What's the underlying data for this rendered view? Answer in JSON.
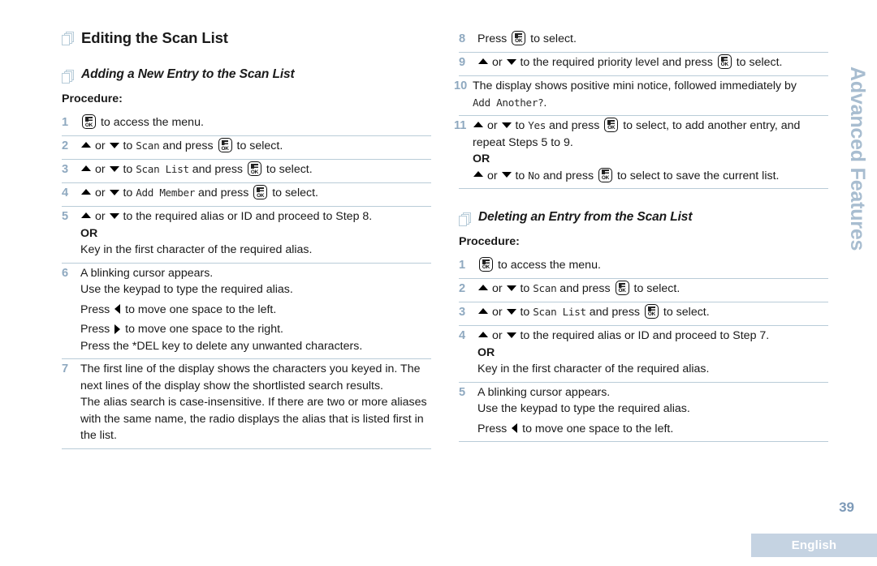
{
  "side_tab": "Advanced Features",
  "footer": {
    "page_number": "39",
    "language": "English"
  },
  "left_column": {
    "section_title": "Editing the Scan List",
    "subsection_title": "Adding a New Entry to the Scan List",
    "procedure_label": "Procedure:",
    "steps": [
      {
        "number": "1",
        "lines": [
          {
            "parts": [
              {
                "type": "okkey"
              },
              {
                "type": "text",
                "value": " to access the menu."
              }
            ]
          }
        ]
      },
      {
        "number": "2",
        "lines": [
          {
            "parts": [
              {
                "type": "tri-up"
              },
              {
                "type": "text",
                "value": " or "
              },
              {
                "type": "tri-down"
              },
              {
                "type": "text",
                "value": " to "
              },
              {
                "type": "lcd",
                "value": "Scan"
              },
              {
                "type": "text",
                "value": " and press "
              },
              {
                "type": "okkey"
              },
              {
                "type": "text",
                "value": " to select."
              }
            ]
          }
        ]
      },
      {
        "number": "3",
        "lines": [
          {
            "parts": [
              {
                "type": "tri-up"
              },
              {
                "type": "text",
                "value": " or "
              },
              {
                "type": "tri-down"
              },
              {
                "type": "text",
                "value": " to "
              },
              {
                "type": "lcd",
                "value": "Scan List"
              },
              {
                "type": "text",
                "value": " and press "
              },
              {
                "type": "okkey"
              },
              {
                "type": "text",
                "value": " to select."
              }
            ]
          }
        ]
      },
      {
        "number": "4",
        "lines": [
          {
            "parts": [
              {
                "type": "tri-up"
              },
              {
                "type": "text",
                "value": " or "
              },
              {
                "type": "tri-down"
              },
              {
                "type": "text",
                "value": " to "
              },
              {
                "type": "lcd",
                "value": "Add Member"
              },
              {
                "type": "text",
                "value": " and press "
              },
              {
                "type": "okkey"
              },
              {
                "type": "text",
                "value": " to select."
              }
            ]
          }
        ]
      },
      {
        "number": "5",
        "lines": [
          {
            "parts": [
              {
                "type": "tri-up"
              },
              {
                "type": "text",
                "value": " or "
              },
              {
                "type": "tri-down"
              },
              {
                "type": "text",
                "value": " to the required alias or ID and proceed to Step 8."
              }
            ]
          },
          {
            "bold": true,
            "parts": [
              {
                "type": "text",
                "value": "OR"
              }
            ]
          },
          {
            "parts": [
              {
                "type": "text",
                "value": "Key in the first character of the required alias."
              }
            ]
          }
        ]
      },
      {
        "number": "6",
        "lines": [
          {
            "parts": [
              {
                "type": "text",
                "value": "A blinking cursor appears."
              }
            ]
          },
          {
            "parts": [
              {
                "type": "text",
                "value": "Use the keypad to type the required alias."
              }
            ]
          },
          {
            "gap": true,
            "parts": [
              {
                "type": "text",
                "value": "Press "
              },
              {
                "type": "tri-left"
              },
              {
                "type": "text",
                "value": " to move one space to the left."
              }
            ]
          },
          {
            "gap": true,
            "parts": [
              {
                "type": "text",
                "value": "Press "
              },
              {
                "type": "tri-right"
              },
              {
                "type": "text",
                "value": " to move one space to the right."
              }
            ]
          },
          {
            "parts": [
              {
                "type": "text",
                "value": "Press the *DEL key to delete any unwanted characters."
              }
            ]
          }
        ]
      },
      {
        "number": "7",
        "lines": [
          {
            "parts": [
              {
                "type": "text",
                "value": "The first line of the display shows the characters you keyed in. The next lines of the display show the shortlisted search results."
              }
            ]
          },
          {
            "parts": [
              {
                "type": "text",
                "value": "The alias search is case-insensitive. If there are two or more aliases with the same name, the radio displays the alias that is listed first in the list."
              }
            ]
          }
        ]
      }
    ]
  },
  "right_column": {
    "steps_continued": [
      {
        "number": "8",
        "lines": [
          {
            "parts": [
              {
                "type": "text",
                "value": "Press "
              },
              {
                "type": "okkey"
              },
              {
                "type": "text",
                "value": " to select."
              }
            ]
          }
        ]
      },
      {
        "number": "9",
        "lines": [
          {
            "parts": [
              {
                "type": "tri-up"
              },
              {
                "type": "text",
                "value": " or "
              },
              {
                "type": "tri-down"
              },
              {
                "type": "text",
                "value": " to the required priority level and press "
              },
              {
                "type": "okkey"
              },
              {
                "type": "text",
                "value": " to select."
              }
            ]
          }
        ]
      },
      {
        "number": "10",
        "lines": [
          {
            "parts": [
              {
                "type": "text",
                "value": "The display shows positive mini notice, followed immediately by "
              },
              {
                "type": "lcd",
                "value": "Add Another?"
              },
              {
                "type": "text",
                "value": "."
              }
            ]
          }
        ]
      },
      {
        "number": "11",
        "lines": [
          {
            "parts": [
              {
                "type": "tri-up"
              },
              {
                "type": "text",
                "value": " or "
              },
              {
                "type": "tri-down"
              },
              {
                "type": "text",
                "value": " to "
              },
              {
                "type": "lcd",
                "value": "Yes"
              },
              {
                "type": "text",
                "value": " and press "
              },
              {
                "type": "okkey"
              },
              {
                "type": "text",
                "value": " to select, to add another entry, and repeat Steps 5 to 9."
              }
            ]
          },
          {
            "bold": true,
            "parts": [
              {
                "type": "text",
                "value": "OR"
              }
            ]
          },
          {
            "parts": [
              {
                "type": "tri-up"
              },
              {
                "type": "text",
                "value": " or "
              },
              {
                "type": "tri-down"
              },
              {
                "type": "text",
                "value": " to "
              },
              {
                "type": "lcd",
                "value": "No"
              },
              {
                "type": "text",
                "value": " and press "
              },
              {
                "type": "okkey"
              },
              {
                "type": "text",
                "value": " to select to save the current list."
              }
            ]
          }
        ]
      }
    ],
    "subsection_title": "Deleting an Entry from the Scan List",
    "procedure_label": "Procedure:",
    "steps": [
      {
        "number": "1",
        "lines": [
          {
            "parts": [
              {
                "type": "okkey"
              },
              {
                "type": "text",
                "value": " to access the menu."
              }
            ]
          }
        ]
      },
      {
        "number": "2",
        "lines": [
          {
            "parts": [
              {
                "type": "tri-up"
              },
              {
                "type": "text",
                "value": " or "
              },
              {
                "type": "tri-down"
              },
              {
                "type": "text",
                "value": " to "
              },
              {
                "type": "lcd",
                "value": "Scan"
              },
              {
                "type": "text",
                "value": " and press "
              },
              {
                "type": "okkey"
              },
              {
                "type": "text",
                "value": " to select."
              }
            ]
          }
        ]
      },
      {
        "number": "3",
        "lines": [
          {
            "parts": [
              {
                "type": "tri-up"
              },
              {
                "type": "text",
                "value": " or "
              },
              {
                "type": "tri-down"
              },
              {
                "type": "text",
                "value": " to "
              },
              {
                "type": "lcd",
                "value": "Scan List"
              },
              {
                "type": "text",
                "value": " and press "
              },
              {
                "type": "okkey"
              },
              {
                "type": "text",
                "value": " to select."
              }
            ]
          }
        ]
      },
      {
        "number": "4",
        "lines": [
          {
            "parts": [
              {
                "type": "tri-up"
              },
              {
                "type": "text",
                "value": " or "
              },
              {
                "type": "tri-down"
              },
              {
                "type": "text",
                "value": " to the required alias or ID and proceed to Step 7."
              }
            ]
          },
          {
            "bold": true,
            "parts": [
              {
                "type": "text",
                "value": "OR"
              }
            ]
          },
          {
            "parts": [
              {
                "type": "text",
                "value": "Key in the first character of the required alias."
              }
            ]
          }
        ]
      },
      {
        "number": "5",
        "lines": [
          {
            "parts": [
              {
                "type": "text",
                "value": "A blinking cursor appears."
              }
            ]
          },
          {
            "parts": [
              {
                "type": "text",
                "value": "Use the keypad to type the required alias."
              }
            ]
          },
          {
            "gap": true,
            "parts": [
              {
                "type": "text",
                "value": "Press "
              },
              {
                "type": "tri-left"
              },
              {
                "type": "text",
                "value": " to move one space to the left."
              }
            ]
          }
        ]
      }
    ]
  },
  "colors": {
    "step_number": "#8fa9c0",
    "rule": "#b9ccd8",
    "side_tab": "#a8bdd0",
    "lang_bar": "#c5d3e2",
    "page_number": "#7d9ab8",
    "icon_outline": "#b6cbd8"
  }
}
